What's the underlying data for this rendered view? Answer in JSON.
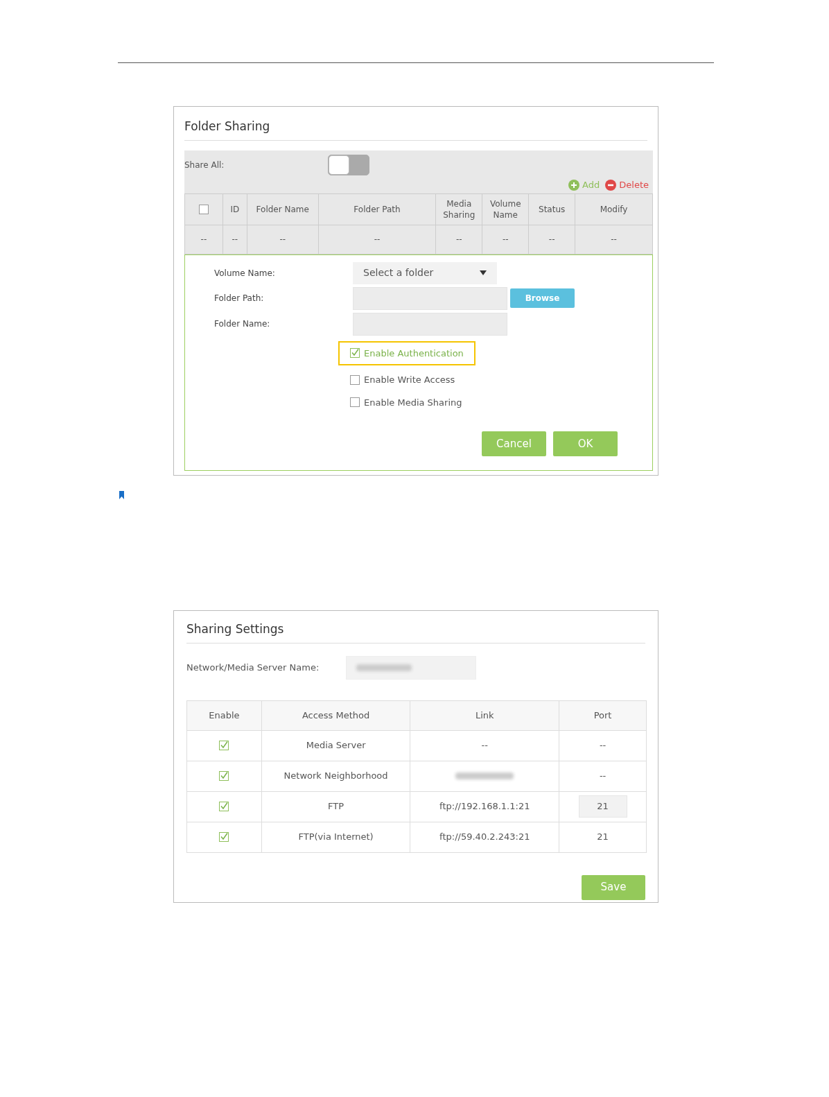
{
  "folder_sharing": {
    "title": "Folder Sharing",
    "share_all": {
      "label": "Share All:",
      "on": false
    },
    "actions": [
      {
        "label": "Add",
        "kind": "add"
      },
      {
        "label": "Delete",
        "kind": "delete"
      }
    ],
    "table": {
      "select_all_checked": false,
      "columns": [
        "",
        "ID",
        "Folder Name",
        "Folder Path",
        "Media Sharing",
        "Volume Name",
        "Status",
        "Modify"
      ],
      "rows": [
        [
          "--",
          "--",
          "--",
          "--",
          "--",
          "--",
          "--",
          "--"
        ]
      ]
    },
    "form": {
      "fields": [
        {
          "label": "Volume Name:",
          "kind": "select",
          "value": "Select a folder"
        },
        {
          "label": "Folder Path:",
          "kind": "text",
          "button": "Browse"
        },
        {
          "label": "Folder Name:",
          "kind": "text"
        }
      ],
      "options": [
        {
          "label": "Enable Authentication",
          "checked": true,
          "highlighted": true
        },
        {
          "label": "Enable Write Access",
          "checked": false,
          "highlighted": false
        },
        {
          "label": "Enable Media Sharing",
          "checked": false,
          "highlighted": false
        }
      ],
      "buttons": [
        "Cancel",
        "OK"
      ]
    }
  },
  "sharing_settings": {
    "title": "Sharing Settings",
    "server_name_label": "Network/Media Server Name:",
    "columns": [
      "Enable",
      "Access Method",
      "Link",
      "Port"
    ],
    "rows": [
      {
        "enabled": true,
        "method": "Media Server",
        "link": "--",
        "port": "--",
        "kind": "text"
      },
      {
        "enabled": true,
        "method": "Network Neighborhood",
        "port": "--",
        "kind": "text"
      },
      {
        "enabled": true,
        "method": "FTP",
        "link": "ftp://192.168.1.1:21",
        "port": "21",
        "kind": "input"
      },
      {
        "enabled": true,
        "method": "FTP(via Internet)",
        "link": "ftp://59.40.2.243:21",
        "port": "21",
        "kind": "text"
      }
    ],
    "save": "Save"
  }
}
